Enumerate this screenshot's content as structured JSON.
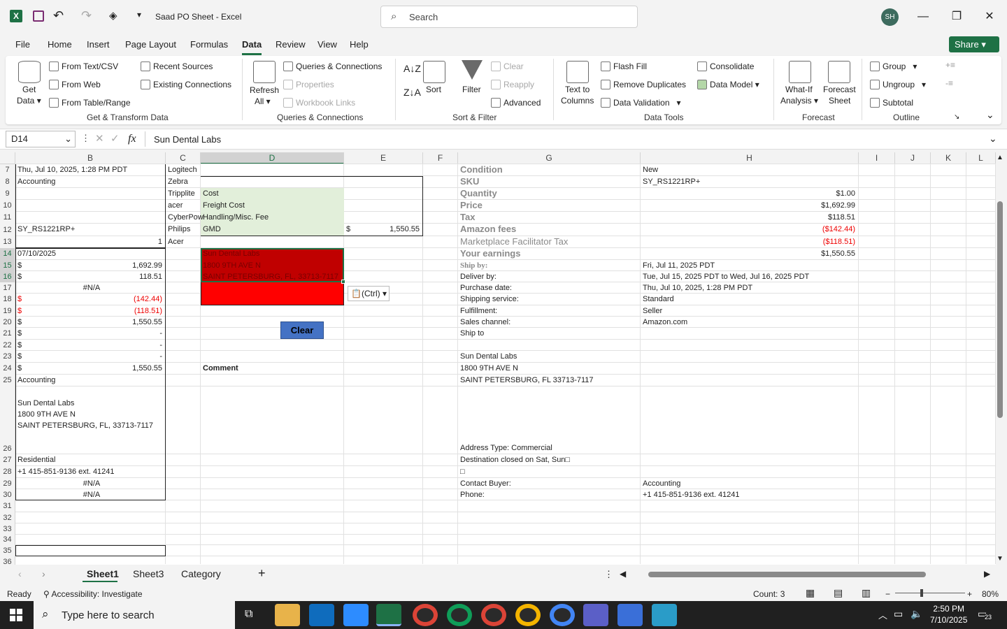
{
  "titlebar": {
    "title": "Saad PO Sheet  -  Excel",
    "search": "Search",
    "avatar": "SH"
  },
  "menu": {
    "items": [
      "File",
      "Home",
      "Insert",
      "Page Layout",
      "Formulas",
      "Data",
      "Review",
      "View",
      "Help"
    ],
    "share": "Share"
  },
  "ribbon": {
    "get_data": "Get",
    "get_data2": "Data",
    "from_text": "From Text/CSV",
    "from_web": "From Web",
    "from_table": "From Table/Range",
    "recent": "Recent Sources",
    "existing": "Existing Connections",
    "g_transform": "Get & Transform Data",
    "refresh": "Refresh",
    "refresh2": "All",
    "queries": "Queries & Connections",
    "properties": "Properties",
    "workbook_links": "Workbook Links",
    "g_queries": "Queries & Connections",
    "sort": "Sort",
    "filter": "Filter",
    "clear": "Clear",
    "reapply": "Reapply",
    "advanced": "Advanced",
    "g_sort": "Sort & Filter",
    "text_to_cols": "Text to",
    "text_to_cols2": "Columns",
    "flash": "Flash Fill",
    "remove_dup": "Remove Duplicates",
    "validation": "Data Validation",
    "consolidate": "Consolidate",
    "data_model": "Data Model",
    "g_tools": "Data Tools",
    "whatif": "What-If",
    "whatif2": "Analysis",
    "forecast": "Forecast",
    "forecast2": "Sheet",
    "g_forecast": "Forecast",
    "group": "Group",
    "ungroup": "Ungroup",
    "subtotal": "Subtotal",
    "g_outline": "Outline"
  },
  "formula_bar": {
    "namebox": "D14",
    "fx": "fx",
    "content": "Sun Dental Labs"
  },
  "columns": [
    "B",
    "C",
    "D",
    "E",
    "F",
    "G",
    "H",
    "I",
    "J",
    "K",
    "L"
  ],
  "rows": [
    "7",
    "8",
    "9",
    "10",
    "11",
    "12",
    "13",
    "14",
    "15",
    "16",
    "17",
    "18",
    "19",
    "20",
    "21",
    "22",
    "23",
    "24",
    "25",
    "26",
    "27",
    "28",
    "29",
    "30",
    "31",
    "32",
    "33",
    "34",
    "35",
    "36"
  ],
  "cells": {
    "b7": "Thu, Jul 10, 2025, 1:28 PM PDT",
    "b8": "Accounting",
    "b12": "SY_RS1221RP+",
    "b13": "1",
    "b14": "07/10/2025",
    "b15a": "$",
    "b15b": "1,692.99",
    "b16a": "$",
    "b16b": "118.51",
    "b17": "#N/A",
    "b18a": "$",
    "b18b": "(142.44)",
    "b19a": "$",
    "b19b": "(118.51)",
    "b20a": "$",
    "b20b": "1,550.55",
    "b21a": "$",
    "b21b": "-",
    "b22a": "$",
    "b22b": "-",
    "b23a": "$",
    "b23b": "-",
    "b24a": "$",
    "b24b": "1,550.55",
    "b25": "Accounting",
    "b26a": "Sun Dental Labs",
    "b26b": "1800 9TH AVE N",
    "b26c": "SAINT PETERSBURG, FL, 33713-7117",
    "b27": "Residential",
    "b28": "+1 415-851-9136 ext. 41241",
    "b29": "#N/A",
    "b30": "#N/A",
    "c7": "Logitech",
    "c8": "Zebra",
    "c9": "Tripplite",
    "c10": "acer",
    "c11": "CyberPow",
    "c12": "Philips",
    "c13": "Acer",
    "d9": "Cost",
    "d10": "Freight Cost",
    "d11": "Handling/Misc. Fee",
    "d12": "GMD",
    "e12a": "$",
    "e12b": "1,550.55",
    "d14": "Sun Dental Labs",
    "d15": "1800 9TH AVE N",
    "d16": "SAINT PETERSBURG, FL, 33713-7117",
    "d24": "Comment",
    "g7": "Condition",
    "g8": "SKU",
    "g9": "Quantity",
    "g10": "Price",
    "g11": "Tax",
    "g12": "Amazon fees",
    "g13": "Marketplace Facilitator Tax",
    "g14": "Your earnings",
    "g15": "Ship by:",
    "g16": "Deliver by:",
    "g17": "Purchase date:",
    "g18": "Shipping service:",
    "g19": "Fulfillment:",
    "g20": "Sales channel:",
    "g21": "Ship to",
    "g23": "Sun Dental Labs",
    "g24": "1800 9TH AVE N",
    "g25": "SAINT PETERSBURG, FL 33713-7117",
    "g26": "Address Type:  Commercial",
    "g27": "Destination closed on Sat, Sun□",
    "g28": "□",
    "g29": "Contact Buyer:",
    "g30": "Phone:",
    "h7": "New",
    "h8": "SY_RS1221RP+",
    "h9": "$1.00",
    "h10": "$1,692.99",
    "h11": "$118.51",
    "h12": "($142.44)",
    "h13": "($118.51)",
    "h14": "$1,550.55",
    "h15": "Fri, Jul 11, 2025 PDT",
    "h16": "Tue, Jul 15, 2025 PDT to Wed, Jul 16, 2025 PDT",
    "h17": "Thu, Jul 10, 2025, 1:28 PM PDT",
    "h18": "Standard",
    "h19": "Seller",
    "h20": "Amazon.com",
    "h29": "Accounting",
    "h30": "+1 415-851-9136 ext. 41241"
  },
  "clear_button": "Clear",
  "paste_options": "(Ctrl)",
  "sheets": [
    "Sheet1",
    "Sheet3",
    "Category"
  ],
  "status": {
    "ready": "Ready",
    "accessibility": "Accessibility: Investigate",
    "count": "Count: 3",
    "zoom": "80%"
  },
  "taskbar": {
    "search": "Type here to search",
    "time": "2:50 PM",
    "date": "7/10/2025",
    "notif": "23"
  },
  "colors": {
    "excel_green": "#1e7145",
    "red_fill": "#ff0000",
    "dark_red": "#c00000",
    "light_green": "#e2efda",
    "button_blue": "#4472c4"
  }
}
